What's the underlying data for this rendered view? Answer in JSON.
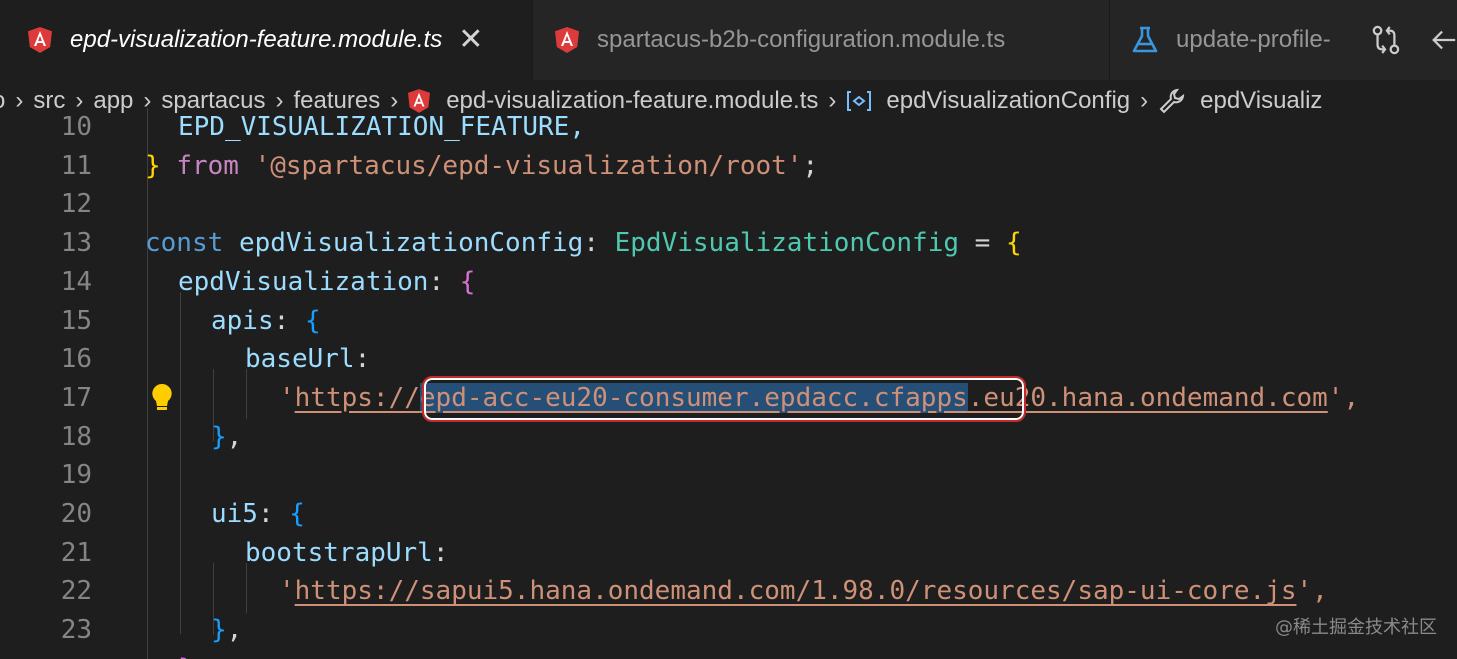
{
  "tabs": [
    {
      "label": "epd-visualization-feature.module.ts",
      "icon": "angular-icon",
      "active": true
    },
    {
      "label": "spartacus-b2b-configuration.module.ts",
      "icon": "angular-icon",
      "active": false
    },
    {
      "label": "update-profile-",
      "icon": "flask-icon",
      "active": false
    }
  ],
  "tab_close_glyph": "✕",
  "breadcrumb": {
    "leading": "o",
    "items": [
      "src",
      "app",
      "spartacus",
      "features"
    ],
    "file": "epd-visualization-feature.module.ts",
    "symbol": "epdVisualizationConfig",
    "property": "epdVisualiz"
  },
  "editor": {
    "line_numbers": [
      "10",
      "11",
      "12",
      "13",
      "14",
      "15",
      "16",
      "17",
      "18",
      "19",
      "20",
      "21",
      "22",
      "23"
    ],
    "line10": "EPD_VISUALIZATION_FEATURE,",
    "line11": {
      "brace": "}",
      "from": "from",
      "module": "'@spartacus/epd-visualization/root'",
      "semi": ";"
    },
    "line13": {
      "const": "const",
      "name": "epdVisualizationConfig",
      "colon": ":",
      "type": "EpdVisualizationConfig",
      "eq": " = ",
      "brace": "{"
    },
    "line14": {
      "key": "epdVisualization",
      "colon": ": ",
      "brace": "{"
    },
    "line15": {
      "key": "apis",
      "colon": ": ",
      "brace": "{"
    },
    "line16": {
      "key": "baseUrl",
      "colon": ":"
    },
    "line17": {
      "quote": "'",
      "scheme": "https://",
      "selected": "epd-acc-eu20-consumer.epdacc.cfapps",
      "rest": ".eu20.hana.ondemand.com",
      "end": "',"
    },
    "line18": {
      "brace": "}",
      "comma": ","
    },
    "line20": {
      "key": "ui5",
      "colon": ": ",
      "brace": "{"
    },
    "line21": {
      "key": "bootstrapUrl",
      "colon": ":"
    },
    "line22": {
      "quote": "'",
      "url": "https://sapui5.hana.ondemand.com/1.98.0/resources/sap-ui-core.js",
      "end": "',"
    },
    "line23": {
      "brace": "}",
      "comma": ","
    },
    "line24": "}"
  },
  "watermark": "@稀土掘金技术社区",
  "colors": {
    "keyword": "#569cd6",
    "variable": "#9cdcfe",
    "type": "#4ec9b0",
    "string": "#ce9178",
    "import": "#c586c0",
    "selection": "#264f78",
    "highlight_outline": "#c42b2b"
  }
}
